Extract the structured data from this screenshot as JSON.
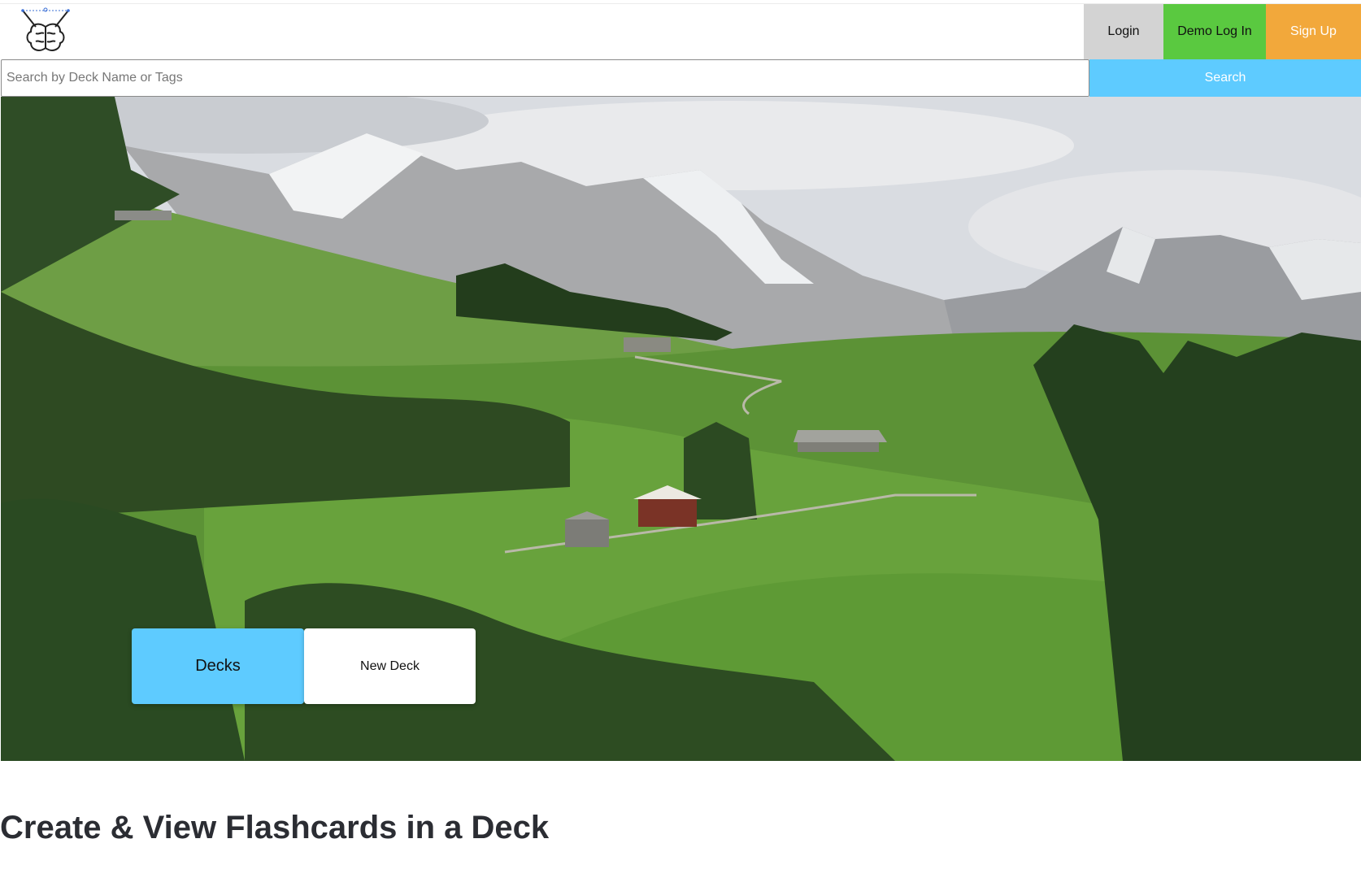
{
  "header": {
    "logo_icon": "brain-logo-icon",
    "login_label": "Login",
    "demo_login_label": "Demo Log In",
    "signup_label": "Sign Up"
  },
  "search": {
    "placeholder": "Search by Deck Name or Tags",
    "value": "",
    "button_label": "Search"
  },
  "hero": {
    "decks_label": "Decks",
    "new_deck_label": "New Deck"
  },
  "main": {
    "title": "Create & View Flashcards in a Deck"
  },
  "colors": {
    "login_bg": "#d3d3d3",
    "demo_bg": "#5ac940",
    "signup_bg": "#f2a83b",
    "accent_blue": "#5ecbff"
  }
}
